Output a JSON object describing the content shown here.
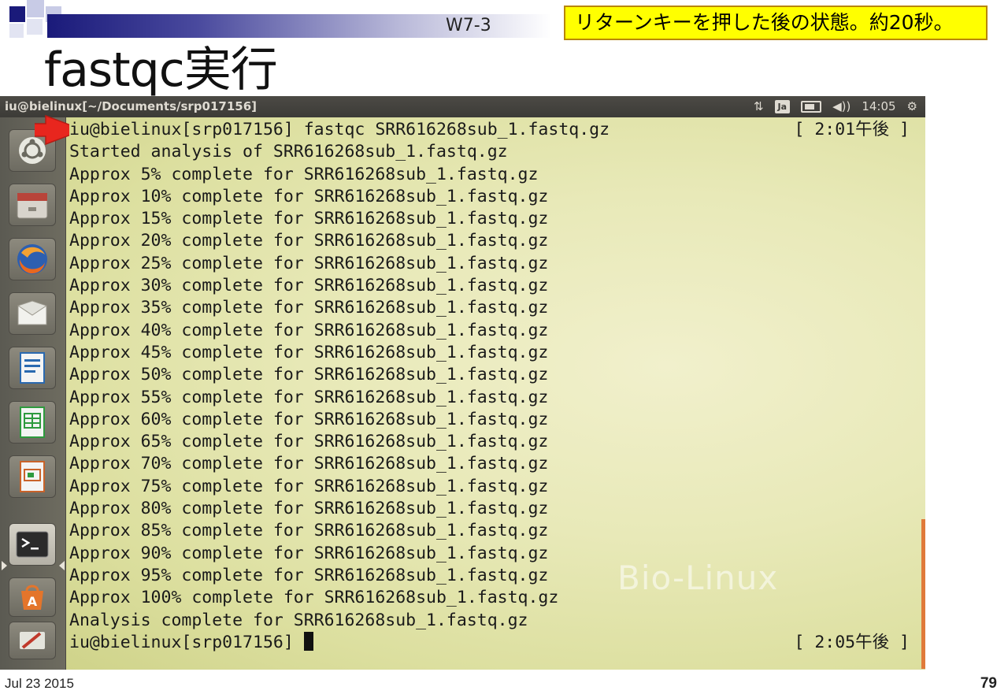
{
  "slide": {
    "id_label": "W7-3",
    "note": "リターンキーを押した後の状態。約20秒。",
    "title": "fastqc実行",
    "date": "Jul 23 2015",
    "page_number": "79",
    "header_color": "#1a1a7a",
    "note_bg": "#ffff00"
  },
  "window": {
    "title": "iu@bielinux[~/Documents/srp017156]"
  },
  "tray": {
    "keyboard": "Ja",
    "clock": "14:05",
    "icons": [
      "sort-arrows-icon",
      "keyboard-layout-icon",
      "battery-icon",
      "volume-icon",
      "gear-icon"
    ]
  },
  "launcher": {
    "items": [
      {
        "name": "dash-icon"
      },
      {
        "name": "file-manager-icon"
      },
      {
        "name": "firefox-icon"
      },
      {
        "name": "mail-icon"
      },
      {
        "name": "writer-icon"
      },
      {
        "name": "calc-icon"
      },
      {
        "name": "impress-icon"
      },
      {
        "name": "terminal-icon"
      },
      {
        "name": "software-center-icon"
      },
      {
        "name": "settings-icon"
      }
    ]
  },
  "terminal": {
    "watermark": "Bio-Linux",
    "lines": [
      {
        "text": "iu@bielinux[srp017156] fastqc SRR616268sub_1.fastq.gz",
        "ts": "[ 2:01午後 ]"
      },
      {
        "text": "Started analysis of SRR616268sub_1.fastq.gz",
        "ts": ""
      },
      {
        "text": "Approx 5% complete for SRR616268sub_1.fastq.gz",
        "ts": ""
      },
      {
        "text": "Approx 10% complete for SRR616268sub_1.fastq.gz",
        "ts": ""
      },
      {
        "text": "Approx 15% complete for SRR616268sub_1.fastq.gz",
        "ts": ""
      },
      {
        "text": "Approx 20% complete for SRR616268sub_1.fastq.gz",
        "ts": ""
      },
      {
        "text": "Approx 25% complete for SRR616268sub_1.fastq.gz",
        "ts": ""
      },
      {
        "text": "Approx 30% complete for SRR616268sub_1.fastq.gz",
        "ts": ""
      },
      {
        "text": "Approx 35% complete for SRR616268sub_1.fastq.gz",
        "ts": ""
      },
      {
        "text": "Approx 40% complete for SRR616268sub_1.fastq.gz",
        "ts": ""
      },
      {
        "text": "Approx 45% complete for SRR616268sub_1.fastq.gz",
        "ts": ""
      },
      {
        "text": "Approx 50% complete for SRR616268sub_1.fastq.gz",
        "ts": ""
      },
      {
        "text": "Approx 55% complete for SRR616268sub_1.fastq.gz",
        "ts": ""
      },
      {
        "text": "Approx 60% complete for SRR616268sub_1.fastq.gz",
        "ts": ""
      },
      {
        "text": "Approx 65% complete for SRR616268sub_1.fastq.gz",
        "ts": ""
      },
      {
        "text": "Approx 70% complete for SRR616268sub_1.fastq.gz",
        "ts": ""
      },
      {
        "text": "Approx 75% complete for SRR616268sub_1.fastq.gz",
        "ts": ""
      },
      {
        "text": "Approx 80% complete for SRR616268sub_1.fastq.gz",
        "ts": ""
      },
      {
        "text": "Approx 85% complete for SRR616268sub_1.fastq.gz",
        "ts": ""
      },
      {
        "text": "Approx 90% complete for SRR616268sub_1.fastq.gz",
        "ts": ""
      },
      {
        "text": "Approx 95% complete for SRR616268sub_1.fastq.gz",
        "ts": ""
      },
      {
        "text": "Approx 100% complete for SRR616268sub_1.fastq.gz",
        "ts": ""
      },
      {
        "text": "Analysis complete for SRR616268sub_1.fastq.gz",
        "ts": ""
      },
      {
        "text": "iu@bielinux[srp017156] ",
        "ts": "[ 2:05午後 ]",
        "cursor": true
      }
    ]
  }
}
